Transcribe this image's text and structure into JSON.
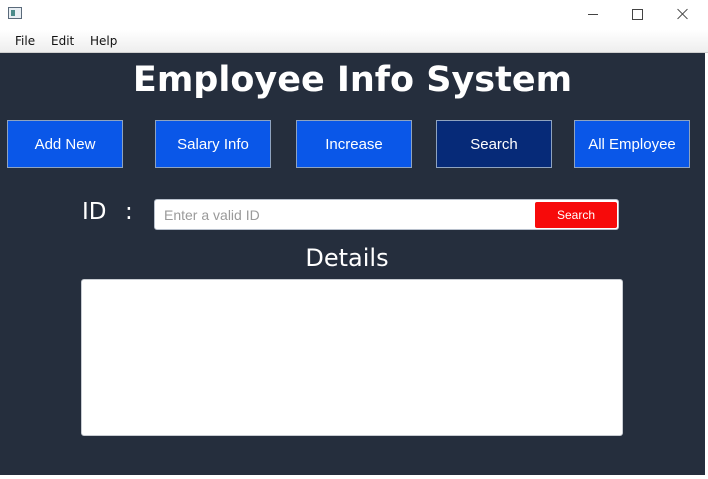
{
  "window": {
    "icon": "app-icon",
    "controls": [
      "minimize-icon",
      "maximize-icon",
      "close-icon"
    ]
  },
  "menu": {
    "items": [
      "File",
      "Edit",
      "Help"
    ]
  },
  "main": {
    "title": "Employee Info System",
    "nav_buttons": [
      {
        "label": "Add New"
      },
      {
        "label": "Salary Info"
      },
      {
        "label": "Increase"
      },
      {
        "label": "Search",
        "active": true
      },
      {
        "label": "All Employee"
      }
    ],
    "id_label": "ID",
    "id_separator": ":",
    "id_input": {
      "value": "",
      "placeholder": "Enter a valid ID"
    },
    "search_button": "Search",
    "details_label": "Details",
    "details_value": ""
  },
  "colors": {
    "background": "#252e3d",
    "nav_button": "#0a57e8",
    "nav_button_active": "#062a78",
    "search_button": "#f70a0a",
    "text": "#ffffff"
  }
}
